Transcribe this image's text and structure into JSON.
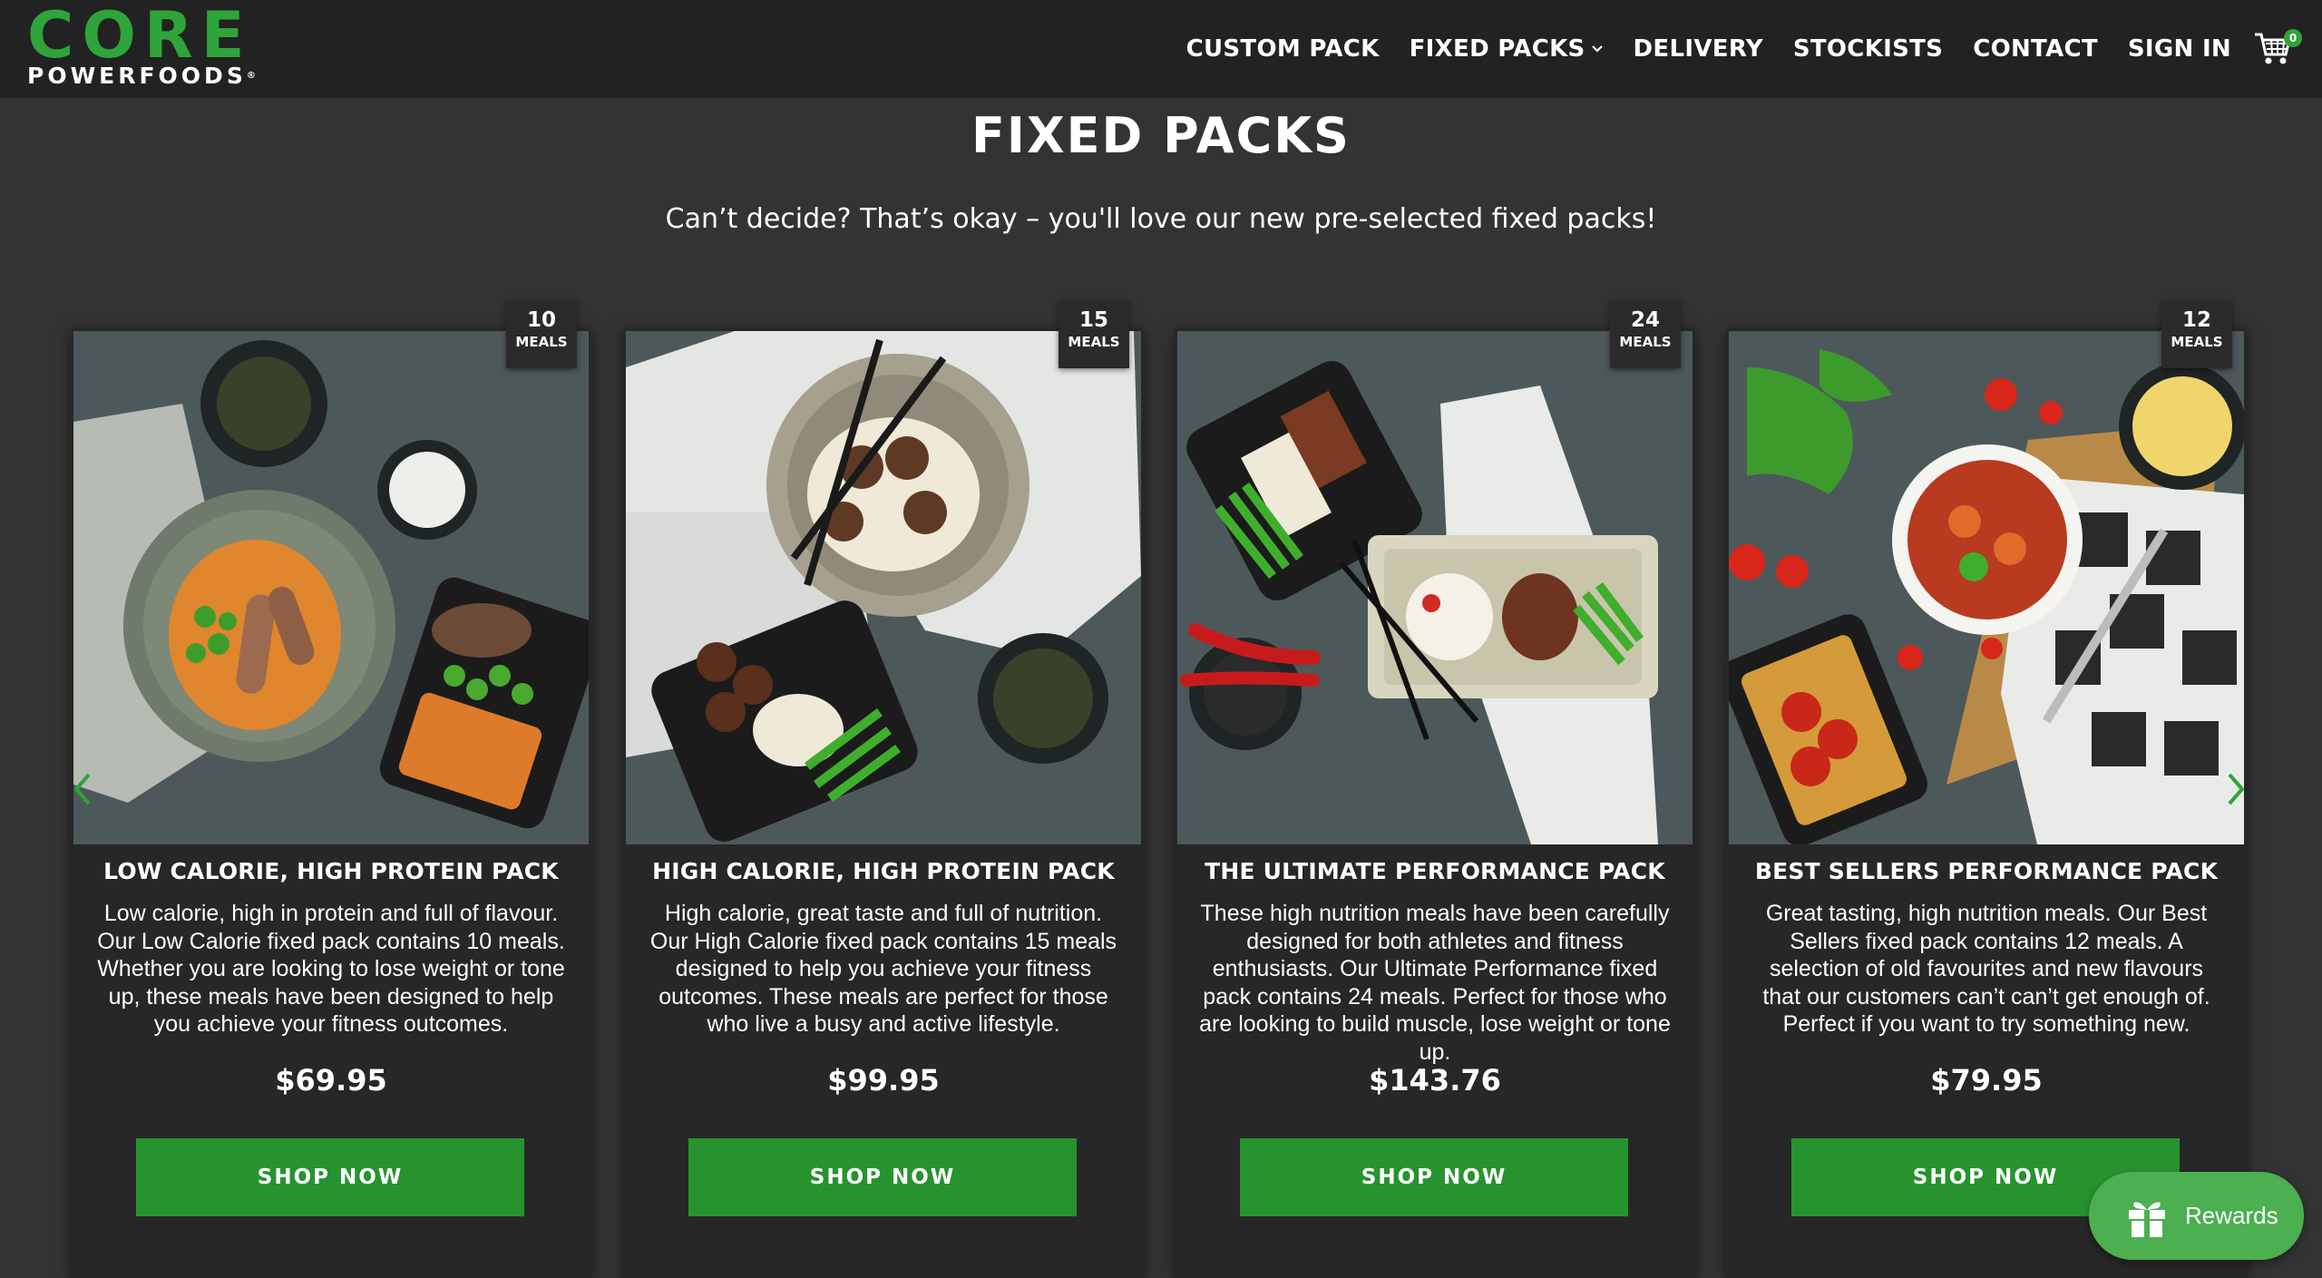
{
  "brand": {
    "name": "CORE",
    "sub": "POWERFOODS",
    "mark": "®"
  },
  "nav": {
    "items": [
      {
        "label": "CUSTOM PACK"
      },
      {
        "label": "FIXED PACKS"
      },
      {
        "label": "DELIVERY"
      },
      {
        "label": "STOCKISTS"
      },
      {
        "label": "CONTACT"
      },
      {
        "label": "SIGN IN"
      }
    ],
    "cart_icon": "cart-icon",
    "cart_count": "0"
  },
  "page": {
    "title": "FIXED PACKS",
    "subtitle": "Can’t decide? That’s okay – you'll love our new pre-selected fixed packs!"
  },
  "cards": [
    {
      "meals_count": "10",
      "meals_label": "MEALS",
      "title": "LOW CALORIE, HIGH PROTEIN PACK",
      "description": "Low calorie, high in protein and full of flavour. Our Low Calorie fixed pack contains 10 meals. Whether you are looking to lose weight or tone up, these meals have been designed to help you achieve your fitness outcomes.",
      "price": "$69.95",
      "button": "SHOP NOW"
    },
    {
      "meals_count": "15",
      "meals_label": "MEALS",
      "title": "HIGH CALORIE, HIGH PROTEIN PACK",
      "description": "High calorie, great taste and full of nutrition. Our High Calorie fixed pack contains 15 meals designed to help you achieve your fitness outcomes. These meals are perfect for those who live a busy and active lifestyle.",
      "price": "$99.95",
      "button": "SHOP NOW"
    },
    {
      "meals_count": "24",
      "meals_label": "MEALS",
      "title": "THE ULTIMATE PERFORMANCE PACK",
      "description": "These high nutrition meals have been carefully designed for both athletes and fitness enthusiasts. Our Ultimate Performance fixed pack contains 24 meals. Perfect for those who are looking to build muscle, lose weight or tone up.",
      "price": "$143.76",
      "button": "SHOP NOW"
    },
    {
      "meals_count": "12",
      "meals_label": "MEALS",
      "title": "BEST SELLERS PERFORMANCE PACK",
      "description": "Great tasting, high nutrition meals. Our Best Sellers fixed pack contains 12 meals. A selection of old favourites and new flavours that our customers can’t can’t get enough of. Perfect if you want to try something new.",
      "price": "$79.95",
      "button": "SHOP NOW"
    }
  ],
  "rewards": {
    "label": "Rewards",
    "icon": "gift-icon"
  },
  "colors": {
    "accent": "#2ea43a",
    "button": "#27932f",
    "header": "#222222",
    "background": "#333333"
  }
}
